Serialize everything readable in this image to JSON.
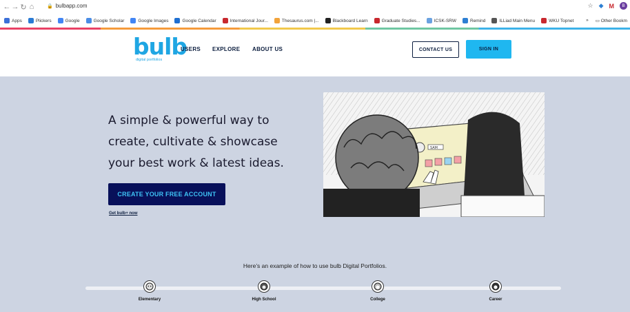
{
  "browser": {
    "url": "bulbapp.com",
    "profile_initial": "B",
    "ext_label": "M"
  },
  "bookmarks": [
    {
      "label": "Apps",
      "color": "#3b6fd8"
    },
    {
      "label": "Plickers",
      "color": "#2a7ad4"
    },
    {
      "label": "Google",
      "color": "#4285f4"
    },
    {
      "label": "Google Scholar",
      "color": "#4a8de6"
    },
    {
      "label": "Google Images",
      "color": "#4285f4"
    },
    {
      "label": "Google Calendar",
      "color": "#1f6fd1"
    },
    {
      "label": "International Jour...",
      "color": "#c8282e"
    },
    {
      "label": "Thesaurus.com |...",
      "color": "#f2a33a"
    },
    {
      "label": "Blackboard Learn",
      "color": "#222222"
    },
    {
      "label": "Graduate Studies...",
      "color": "#c8282e"
    },
    {
      "label": "ICSK-SRW",
      "color": "#6aa2e0"
    },
    {
      "label": "Remind",
      "color": "#2d7fd3"
    },
    {
      "label": "ILLiad Main Menu",
      "color": "#555555"
    },
    {
      "label": "WKU Topnet",
      "color": "#c8282e"
    }
  ],
  "bookmarks_more": "»",
  "bookmarks_other": "Other Bookm",
  "header": {
    "logo_word": "bulb",
    "logo_sub": "digital portfolios",
    "nav": [
      "USERS",
      "EXPLORE",
      "ABOUT US"
    ],
    "contact_label": "CONTACT US",
    "signin_label": "SIGN IN"
  },
  "hero": {
    "headline_lines": [
      "A simple & powerful way to",
      "create, cultivate & showcase",
      "your best work & latest ideas."
    ],
    "cta_label": "CREATE YOUR FREE ACCOUNT",
    "sub_link": "Get bulb+ now",
    "illus_badge": "SAM"
  },
  "example": {
    "text": "Here’s an example of how to use bulb Digital Portfolios.",
    "stages": [
      "Elementary",
      "High School",
      "College",
      "Career"
    ]
  }
}
